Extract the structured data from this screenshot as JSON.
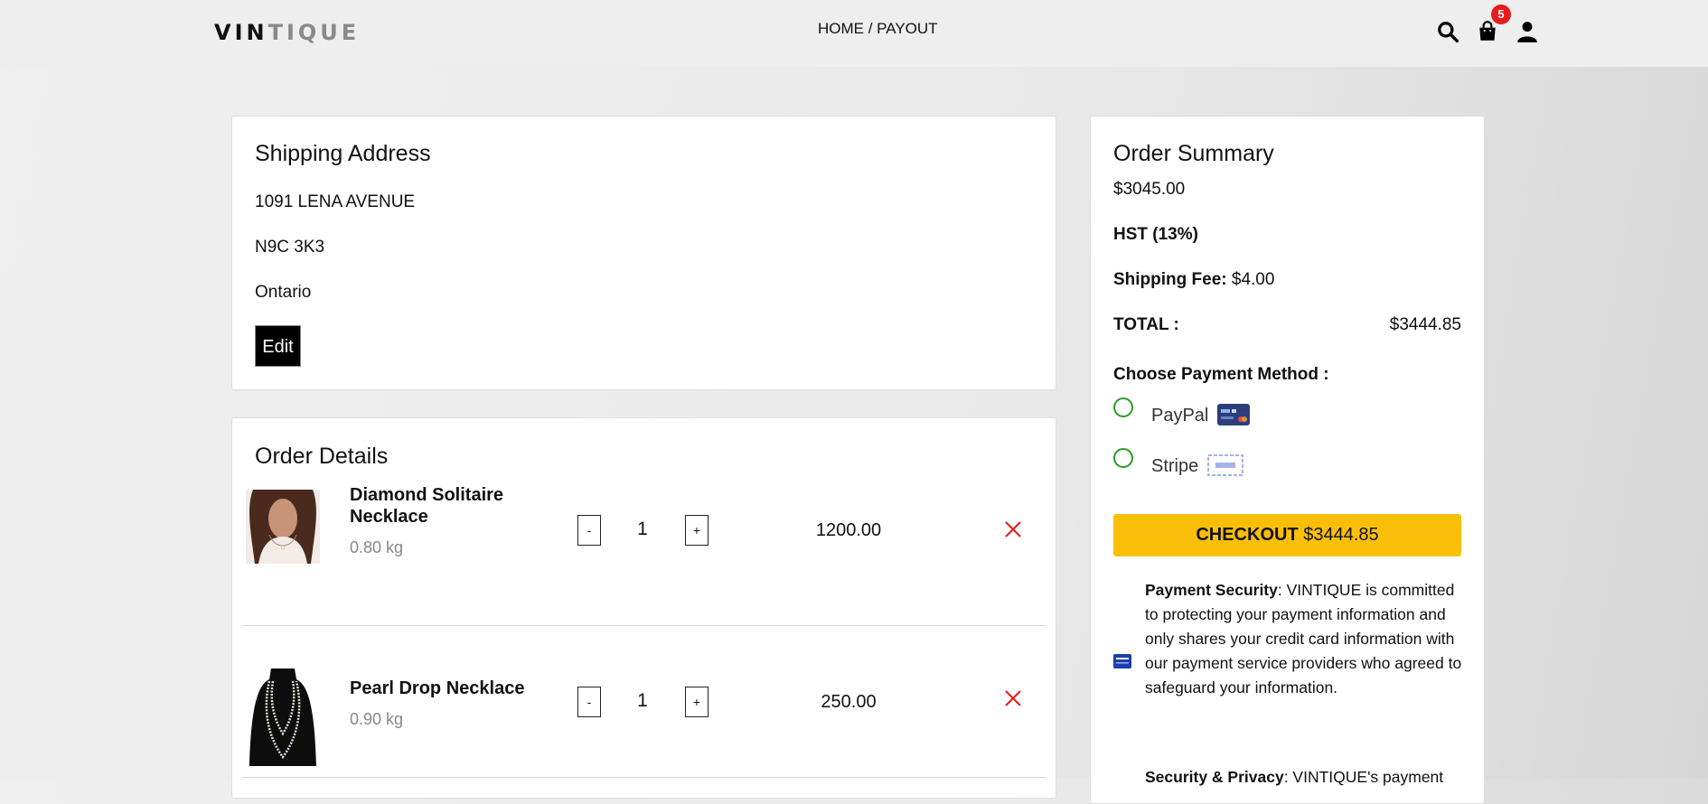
{
  "brand": {
    "part1": "VIN",
    "part2": "TIQUE"
  },
  "breadcrumb": "HOME / PAYOUT",
  "nav": {
    "cart_count": "5",
    "icons": [
      "search-icon",
      "cart-icon",
      "user-icon"
    ]
  },
  "shipping": {
    "title": "Shipping Address",
    "street": "1091 LENA AVENUE",
    "postal": "N9C 3K3",
    "province": "Ontario",
    "edit_label": "Edit"
  },
  "order_details": {
    "title": "Order Details",
    "items": [
      {
        "name": "Diamond Solitaire Necklace",
        "weight": "0.80 kg",
        "qty": "1",
        "price": "1200.00",
        "minus": "-",
        "plus": "+"
      },
      {
        "name": "Pearl Drop Necklace",
        "weight": "0.90 kg",
        "qty": "1",
        "price": "250.00",
        "minus": "-",
        "plus": "+"
      }
    ]
  },
  "summary": {
    "title": "Order Summary",
    "subtotal": "$3045.00",
    "hst_label": "HST (13%)",
    "shipping_label": "Shipping Fee:",
    "shipping_value": "$4.00",
    "total_label": "TOTAL :",
    "total_value": "$3444.85",
    "payment_heading": "Choose Payment Method :",
    "methods": [
      {
        "label": "PayPal"
      },
      {
        "label": "Stripe"
      }
    ],
    "checkout_label": "CHECKOUT",
    "checkout_amount": "$3444.85",
    "security_title": "Payment Security",
    "security_text": ": VINTIQUE is committed to protecting your payment information and only shares your credit card information with our payment service providers who agreed to safeguard your information.",
    "privacy_title": "Security & Privacy",
    "privacy_text": ": VINTIQUE's payment"
  },
  "colors": {
    "accent": "#fbbf0a",
    "badge": "#e61b1b",
    "remove": "#e61b1b",
    "radio": "#2a9a2a"
  }
}
